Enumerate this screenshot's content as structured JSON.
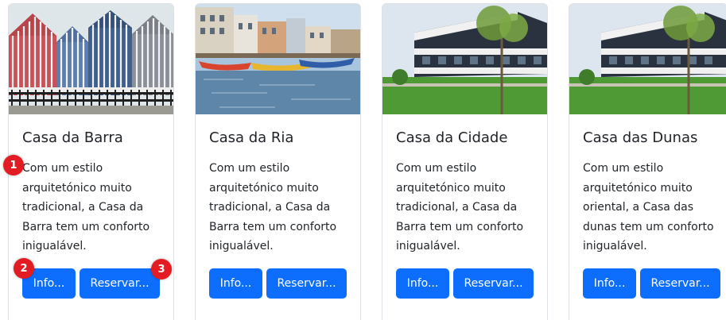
{
  "cards": [
    {
      "title": "Casa da Barra",
      "description": "Com um estilo arquitetónico muito tradicional, a Casa da Barra tem um conforto inigualável.",
      "info_label": "Info...",
      "reserve_label": "Reservar..."
    },
    {
      "title": "Casa da Ria",
      "description": "Com um estilo arquitetónico muito tradicional, a Casa da Barra tem um conforto inigualável.",
      "info_label": "Info...",
      "reserve_label": "Reservar..."
    },
    {
      "title": "Casa da Cidade",
      "description": "Com um estilo arquitetónico muito tradicional, a Casa da Barra tem um conforto inigualável.",
      "info_label": "Info...",
      "reserve_label": "Reservar..."
    },
    {
      "title": "Casa das Dunas",
      "description": "Com um estilo arquitetónico muito oriental, a Casa das dunas tem um conforto inigualável.",
      "info_label": "Info...",
      "reserve_label": "Reservar..."
    }
  ],
  "markers": [
    "1",
    "2",
    "3"
  ],
  "colors": {
    "button": "#0d6efd",
    "marker": "#e31b23",
    "border": "#dee2e6"
  }
}
